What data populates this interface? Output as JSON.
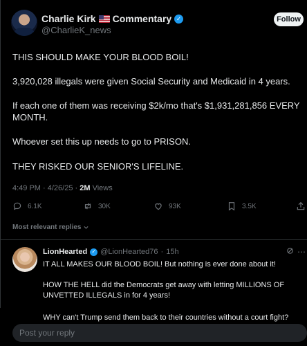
{
  "post": {
    "author_name": "Charlie Kirk",
    "author_suffix": "Commentary",
    "handle": "@CharlieK_news",
    "follow_label": "Follow",
    "lines": [
      "THIS SHOULD MAKE YOUR BLOOD BOIL!",
      "3,920,028 illegals were given Social Security and Medicaid in 4 years.",
      "If each one of them was receiving $2k/mo that's $1,931,281,856 EVERY MONTH.",
      "Whoever set this up needs to go to PRISON.",
      "THEY RISKED OUR SENIOR'S LIFELINE."
    ],
    "time": "4:49 PM",
    "date": "4/26/25",
    "views_count": "2M",
    "views_label": "Views",
    "replies": "6.1K",
    "reposts": "30K",
    "likes": "93K",
    "bookmarks": "3.5K"
  },
  "replies_filter": "Most relevant replies",
  "reply": {
    "name": "LionHearted",
    "handle": "@LionHearted76",
    "age": "15h",
    "lines": [
      "IT ALL MAKES OUR BLOOD BOIL! But nothing is ever done about it!",
      "HOW THE HELL did the Democrats get away with letting MILLIONS OF UNVETTED ILLEGALS in for 4 years!",
      "WHY can't Trump send them back to their countries without a court fight?"
    ]
  },
  "composer": {
    "placeholder": "Post your reply"
  },
  "colors": {
    "accent": "#1d9bf0",
    "muted": "#71767b",
    "background": "#000000"
  }
}
